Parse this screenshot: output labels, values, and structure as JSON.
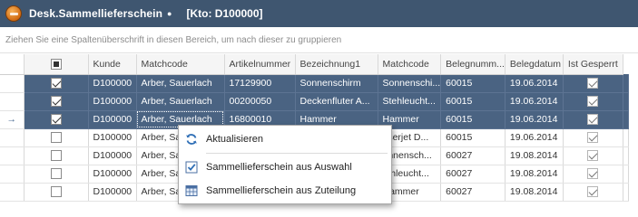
{
  "window": {
    "title": "Desk.Sammellieferschein",
    "modified_marker": "●",
    "account": "[Kto: D100000]"
  },
  "group_hint": "Ziehen Sie eine Spaltenüberschrift in diesen Bereich, um nach dieser zu gruppieren",
  "grid": {
    "columns": [
      "",
      "Kunde",
      "Matchcode",
      "Artikelnummer",
      "Bezeichnung1",
      "Matchcode",
      "Belegnumm...",
      "Belegdatum",
      "Ist Gesperrt"
    ],
    "header_checkbox_state": "partial",
    "focus_indicator": "→",
    "rows": [
      {
        "checked": true,
        "selected": true,
        "kunde": "D100000",
        "matchcode": "Arber, Sauerlach",
        "artikelnummer": "17129900",
        "bezeichnung1": "Sonnenschirm",
        "matchcode2": "Sonnenschi...",
        "belegnummer": "60015",
        "belegdatum": "19.06.2014",
        "gesperrt": true
      },
      {
        "checked": true,
        "selected": true,
        "kunde": "D100000",
        "matchcode": "Arber, Sauerlach",
        "artikelnummer": "00200050",
        "bezeichnung1": "Deckenfluter A...",
        "matchcode2": "Stehleucht...",
        "belegnummer": "60015",
        "belegdatum": "19.06.2014",
        "gesperrt": true
      },
      {
        "checked": true,
        "selected": true,
        "kunde": "D100000",
        "matchcode": "Arber, Sauerlach",
        "artikelnummer": "16800010",
        "bezeichnung1": "Hammer",
        "matchcode2": "Hammer",
        "belegnummer": "60015",
        "belegdatum": "19.06.2014",
        "gesperrt": true
      },
      {
        "checked": false,
        "selected": false,
        "kunde": "D100000",
        "matchcode": "Arber, Sa",
        "artikelnummer": "",
        "bezeichnung1": "",
        "matchcode2": "aserjet D...",
        "belegnummer": "60015",
        "belegdatum": "19.06.2014",
        "gesperrt": true
      },
      {
        "checked": false,
        "selected": false,
        "kunde": "D100000",
        "matchcode": "Arber, Sa",
        "artikelnummer": "",
        "bezeichnung1": "",
        "matchcode2": "onnensch...",
        "belegnummer": "60027",
        "belegdatum": "19.08.2014",
        "gesperrt": true
      },
      {
        "checked": false,
        "selected": false,
        "kunde": "D100000",
        "matchcode": "Arber, Sa",
        "artikelnummer": "",
        "bezeichnung1": "",
        "matchcode2": "tehleucht...",
        "belegnummer": "60027",
        "belegdatum": "19.08.2014",
        "gesperrt": true
      },
      {
        "checked": false,
        "selected": false,
        "kunde": "D100000",
        "matchcode": "Arber, Sa",
        "artikelnummer": "",
        "bezeichnung1": "",
        "matchcode2": "Hammer",
        "belegnummer": "60027",
        "belegdatum": "19.08.2014",
        "gesperrt": true
      }
    ]
  },
  "context_menu": {
    "items": [
      {
        "label": "Aktualisieren",
        "icon": "refresh-icon"
      },
      {
        "label": "Sammellieferschein aus Auswahl",
        "icon": "checkbox-checked-icon"
      },
      {
        "label": "Sammellieferschein aus Zuteilung",
        "icon": "table-grid-icon"
      }
    ]
  },
  "colors": {
    "titlebar": "#3f5670",
    "selection": "#4a6382",
    "accent_icon": "#2f6fb6"
  }
}
